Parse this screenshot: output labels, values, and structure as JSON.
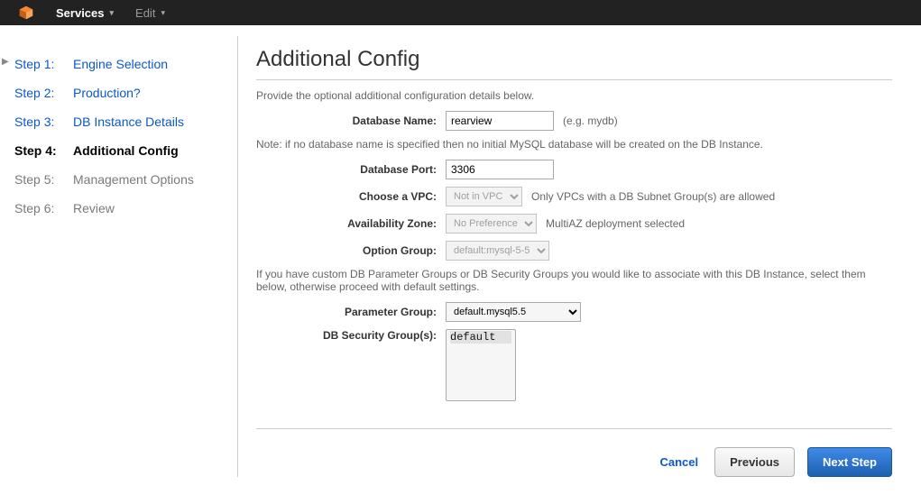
{
  "topbar": {
    "services_label": "Services",
    "edit_label": "Edit"
  },
  "sidebar": {
    "steps": [
      {
        "num": "Step 1:",
        "label": "Engine Selection"
      },
      {
        "num": "Step 2:",
        "label": "Production?"
      },
      {
        "num": "Step 3:",
        "label": "DB Instance Details"
      },
      {
        "num": "Step 4:",
        "label": "Additional Config"
      },
      {
        "num": "Step 5:",
        "label": "Management Options"
      },
      {
        "num": "Step 6:",
        "label": "Review"
      }
    ]
  },
  "page": {
    "title": "Additional Config",
    "intro": "Provide the optional additional configuration details below.",
    "note_db": "Note: if no database name is specified then no initial MySQL database will be created on the DB Instance.",
    "note_groups": "If you have custom DB Parameter Groups or DB Security Groups you would like to associate with this DB Instance, select them below, otherwise proceed with default settings."
  },
  "form": {
    "db_name": {
      "label": "Database Name:",
      "value": "rearview",
      "hint": "(e.g. mydb)"
    },
    "db_port": {
      "label": "Database Port:",
      "value": "3306"
    },
    "vpc": {
      "label": "Choose a VPC:",
      "value": "Not in VPC",
      "hint": "Only VPCs with a DB Subnet Group(s) are allowed"
    },
    "az": {
      "label": "Availability Zone:",
      "value": "No Preference",
      "hint": "MultiAZ deployment selected"
    },
    "option_group": {
      "label": "Option Group:",
      "value": "default:mysql-5-5"
    },
    "param_group": {
      "label": "Parameter Group:",
      "value": "default.mysql5.5"
    },
    "sec_group": {
      "label": "DB Security Group(s):",
      "value": "default"
    }
  },
  "buttons": {
    "cancel": "Cancel",
    "previous": "Previous",
    "next": "Next Step"
  }
}
